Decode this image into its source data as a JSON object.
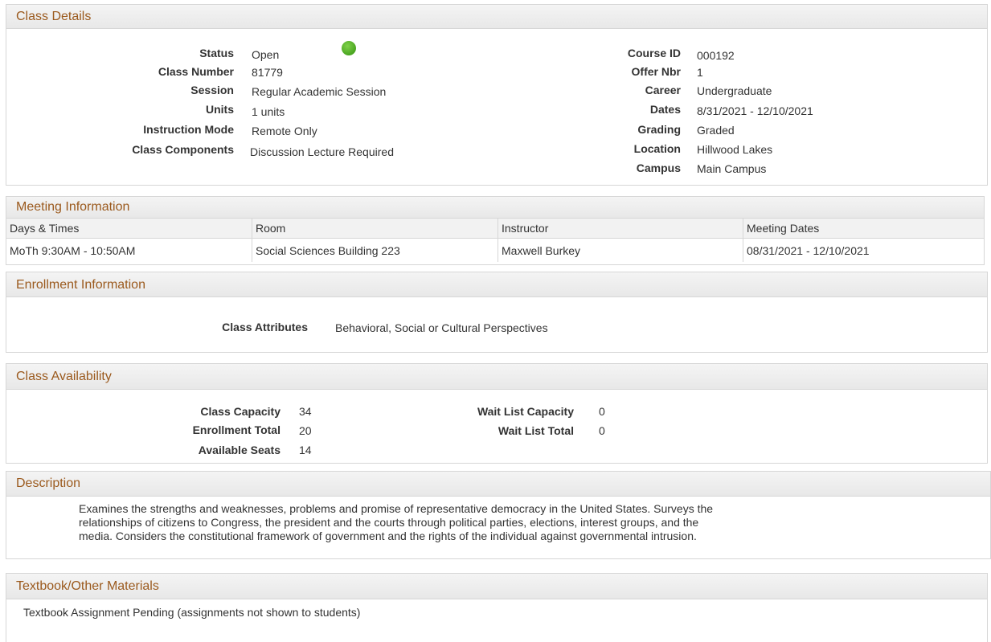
{
  "class_details": {
    "title": "Class Details",
    "left": [
      {
        "label": "Status",
        "value": "Open"
      },
      {
        "label": "Class Number",
        "value": "81779"
      },
      {
        "label": "Session",
        "value": "Regular Academic Session"
      },
      {
        "label": "Units",
        "value": "1 units"
      },
      {
        "label": "Instruction Mode",
        "value": "Remote Only"
      },
      {
        "label": "Class Components",
        "value": "Discussion Lecture Required"
      }
    ],
    "right": [
      {
        "label": "Course ID",
        "value": "000192"
      },
      {
        "label": "Offer Nbr",
        "value": "1"
      },
      {
        "label": "Career",
        "value": "Undergraduate"
      },
      {
        "label": "Dates",
        "value": "8/31/2021 - 12/10/2021"
      },
      {
        "label": "Grading",
        "value": "Graded"
      },
      {
        "label": "Location",
        "value": "Hillwood Lakes"
      },
      {
        "label": "Campus",
        "value": "Main Campus"
      }
    ],
    "status_icon": "green-circle-icon",
    "status_color": "#4aa521"
  },
  "meeting": {
    "title": "Meeting Information",
    "columns": [
      "Days & Times",
      "Room",
      "Instructor",
      "Meeting Dates"
    ],
    "rows": [
      [
        "MoTh 9:30AM - 10:50AM",
        "Social Sciences Building 223",
        "Maxwell Burkey",
        "08/31/2021 - 12/10/2021"
      ]
    ]
  },
  "enrollment": {
    "title": "Enrollment Information",
    "label": "Class Attributes",
    "value": "Behavioral, Social or Cultural Perspectives"
  },
  "availability": {
    "title": "Class Availability",
    "left": [
      {
        "label": "Class Capacity",
        "value": "34"
      },
      {
        "label": "Enrollment Total",
        "value": "20"
      },
      {
        "label": "Available Seats",
        "value": "14"
      }
    ],
    "right": [
      {
        "label": "Wait List Capacity",
        "value": "0"
      },
      {
        "label": "Wait List Total",
        "value": "0"
      }
    ]
  },
  "description": {
    "title": "Description",
    "lines": [
      "Examines the strengths and weaknesses, problems and promise of representative democracy in the United States.  Surveys the",
      "relationships of citizens to Congress, the president and the courts through political parties, elections, interest groups, and the",
      "media.  Considers the constitutional framework of government and the rights of the individual against governmental intrusion."
    ]
  },
  "textbook": {
    "title": "Textbook/Other Materials",
    "text": "Textbook Assignment Pending  (assignments not shown to students)"
  },
  "colors": {
    "header_text": "#9b5a1e",
    "border": "#d6d6d6"
  }
}
